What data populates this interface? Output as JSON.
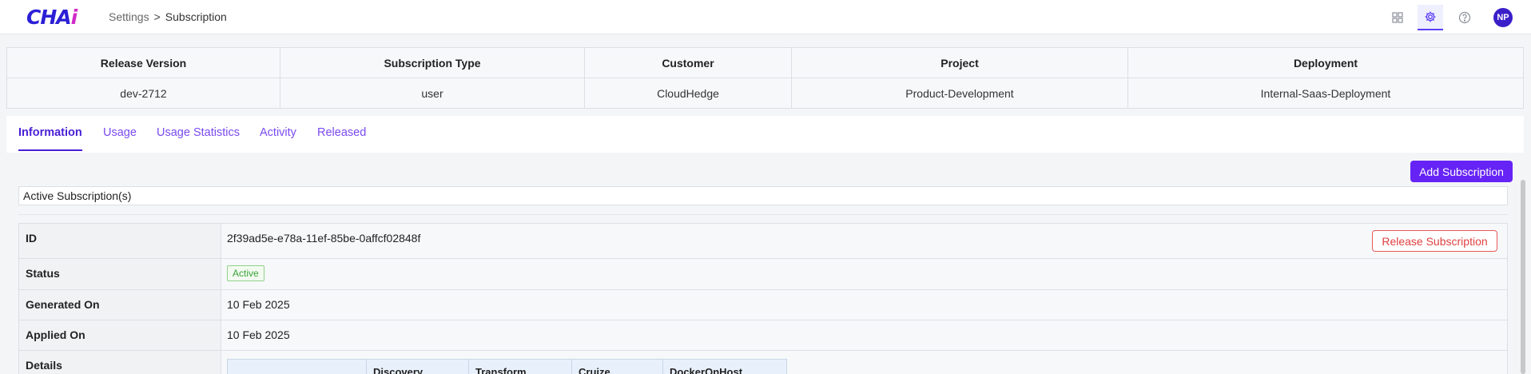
{
  "header": {
    "logo": "CHAi",
    "breadcrumb": {
      "parent": "Settings",
      "separator": ">",
      "current": "Subscription"
    },
    "icons": [
      "apps-grid-icon",
      "gear-icon",
      "help-icon"
    ],
    "avatar_initials": "NP"
  },
  "summary": {
    "headers": [
      "Release Version",
      "Subscription Type",
      "Customer",
      "Project",
      "Deployment"
    ],
    "row": [
      "dev-2712",
      "user",
      "CloudHedge",
      "Product-Development",
      "Internal-Saas-Deployment"
    ]
  },
  "tabs": [
    {
      "label": "Information",
      "active": true
    },
    {
      "label": "Usage",
      "active": false
    },
    {
      "label": "Usage Statistics",
      "active": false
    },
    {
      "label": "Activity",
      "active": false
    },
    {
      "label": "Released",
      "active": false
    }
  ],
  "content": {
    "add_button": "Add Subscription",
    "section_title": "Active Subscription(s)",
    "release_button": "Release Subscription",
    "fields": {
      "id": {
        "label": "ID",
        "value": "2f39ad5e-e78a-11ef-85be-0affcf02848f"
      },
      "status": {
        "label": "Status",
        "value": "Active"
      },
      "generated_on": {
        "label": "Generated On",
        "value": "10 Feb 2025"
      },
      "applied_on": {
        "label": "Applied On",
        "value": "10 Feb 2025"
      },
      "details": {
        "label": "Details"
      }
    },
    "details_columns": [
      "",
      "Discovery",
      "Transform",
      "Cruize",
      "DockerOnHost"
    ]
  },
  "colors": {
    "accent": "#6623f5",
    "tab_active": "#4a1fd6",
    "danger": "#e04040",
    "success": "#3aa33a"
  }
}
